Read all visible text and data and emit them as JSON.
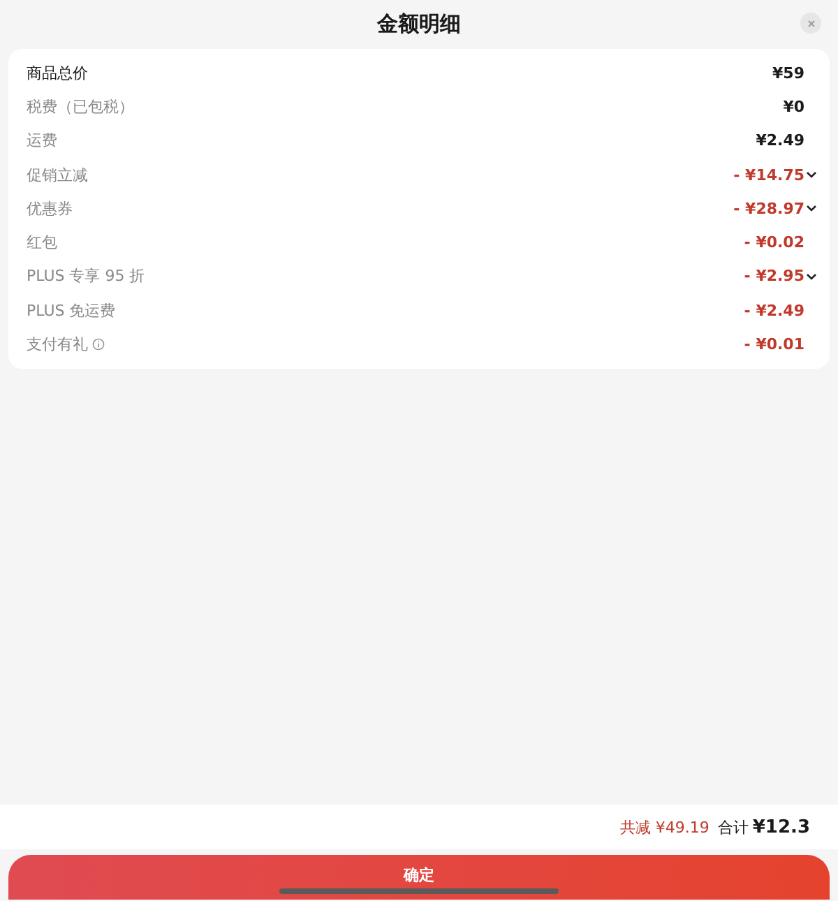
{
  "title": "金额明细",
  "rows": [
    {
      "label": "商品总价",
      "amount": "¥59",
      "kind": "total",
      "expandable": false,
      "info": false
    },
    {
      "label": "税费（已包税）",
      "amount": "¥0",
      "kind": "fee",
      "expandable": false,
      "info": false
    },
    {
      "label": "运费",
      "amount": "¥2.49",
      "kind": "fee",
      "expandable": false,
      "info": false
    },
    {
      "label": "促销立减",
      "amount": "- ¥14.75",
      "kind": "discount",
      "expandable": true,
      "info": false
    },
    {
      "label": "优惠券",
      "amount": "- ¥28.97",
      "kind": "discount",
      "expandable": true,
      "info": false
    },
    {
      "label": "红包",
      "amount": "- ¥0.02",
      "kind": "discount",
      "expandable": false,
      "info": false
    },
    {
      "label": "PLUS 专享 95 折",
      "amount": "- ¥2.95",
      "kind": "discount",
      "expandable": true,
      "info": false
    },
    {
      "label": "PLUS 免运费",
      "amount": "- ¥2.49",
      "kind": "discount",
      "expandable": false,
      "info": false
    },
    {
      "label": "支付有礼",
      "amount": "- ¥0.01",
      "kind": "discount",
      "expandable": false,
      "info": true
    }
  ],
  "summary": {
    "saved": "共减 ¥49.19",
    "total_label": "合计",
    "total": "¥12.3"
  },
  "confirm_button": "确定"
}
